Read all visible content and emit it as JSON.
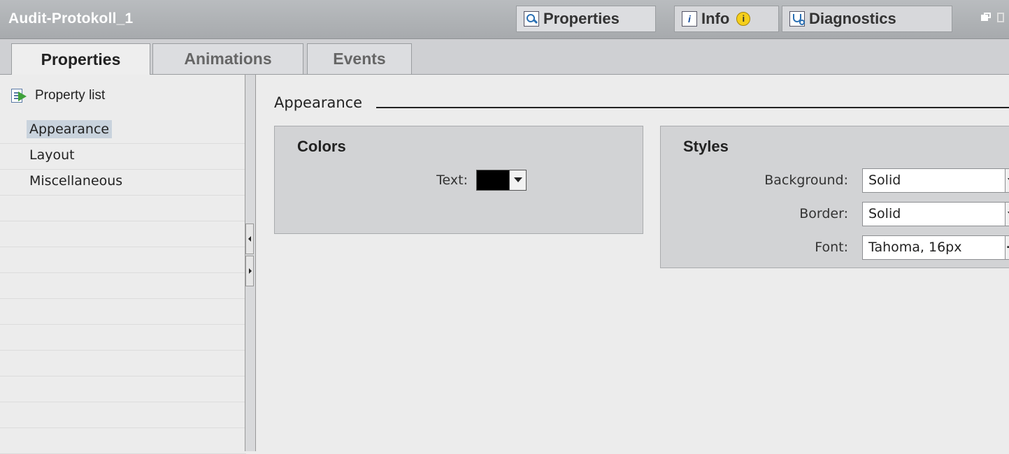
{
  "window": {
    "title": "Audit-Protokoll_1",
    "inspector_tabs": [
      {
        "label": "Properties",
        "icon": "properties-icon",
        "active": true
      },
      {
        "label": "Info",
        "icon": "info-icon",
        "badge_icon": "info-badge-icon",
        "active": false
      },
      {
        "label": "Diagnostics",
        "icon": "diagnostics-icon",
        "active": false
      }
    ]
  },
  "tabs": [
    {
      "label": "Properties",
      "active": true
    },
    {
      "label": "Animations",
      "active": false
    },
    {
      "label": "Events",
      "active": false
    }
  ],
  "sidebar": {
    "header": {
      "label": "Property list",
      "icon": "property-list-icon"
    },
    "items": [
      {
        "label": "Appearance",
        "selected": true
      },
      {
        "label": "Layout",
        "selected": false
      },
      {
        "label": "Miscellaneous",
        "selected": false
      }
    ]
  },
  "main": {
    "section_title": "Appearance",
    "colors": {
      "title": "Colors",
      "text_label": "Text:",
      "text_color": "#000000"
    },
    "styles": {
      "title": "Styles",
      "background_label": "Background:",
      "background_value": "Solid",
      "border_label": "Border:",
      "border_value": "Solid",
      "font_label": "Font:",
      "font_value": "Tahoma, 16px"
    }
  },
  "colors": {
    "titlebar": "#b0b3b6",
    "selection": "#c9d3dd",
    "panel": "#ececec",
    "group": "#d2d3d5"
  }
}
